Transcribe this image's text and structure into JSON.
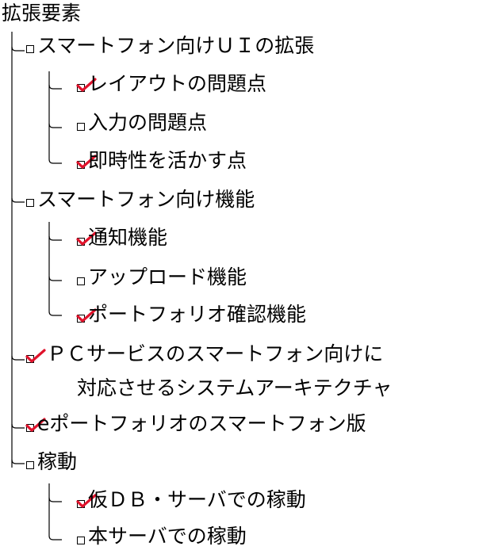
{
  "root": {
    "label": "拡張要素"
  },
  "items": [
    {
      "id": "n1",
      "label": "スマートフォン向けＵＩの拡張",
      "checked": false
    },
    {
      "id": "n1a",
      "label": "レイアウトの問題点",
      "checked": true
    },
    {
      "id": "n1b",
      "label": "入力の問題点",
      "checked": false
    },
    {
      "id": "n1c",
      "label": "即時性を活かす点",
      "checked": true
    },
    {
      "id": "n2",
      "label": "スマートフォン向け機能",
      "checked": false
    },
    {
      "id": "n2a",
      "label": "通知機能",
      "checked": true
    },
    {
      "id": "n2b",
      "label": "アップロード機能",
      "checked": false
    },
    {
      "id": "n2c",
      "label": "ポートフォリオ確認機能",
      "checked": true
    },
    {
      "id": "n3",
      "label": "ＰＣサービスのスマートフォン向けに",
      "label_line2": "対応させるシステムアーキテクチャ",
      "checked": true
    },
    {
      "id": "n4",
      "label": "eポートフォリオのスマートフォン版",
      "checked": true
    },
    {
      "id": "n5",
      "label": "稼動",
      "checked": false
    },
    {
      "id": "n5a",
      "label": "仮ＤＢ・サーバでの稼動",
      "checked": true
    },
    {
      "id": "n5b",
      "label": "本サーバでの稼動",
      "checked": false
    }
  ],
  "colors": {
    "text": "#000000",
    "check_mark": "#e0122b",
    "background": "#ffffff"
  }
}
